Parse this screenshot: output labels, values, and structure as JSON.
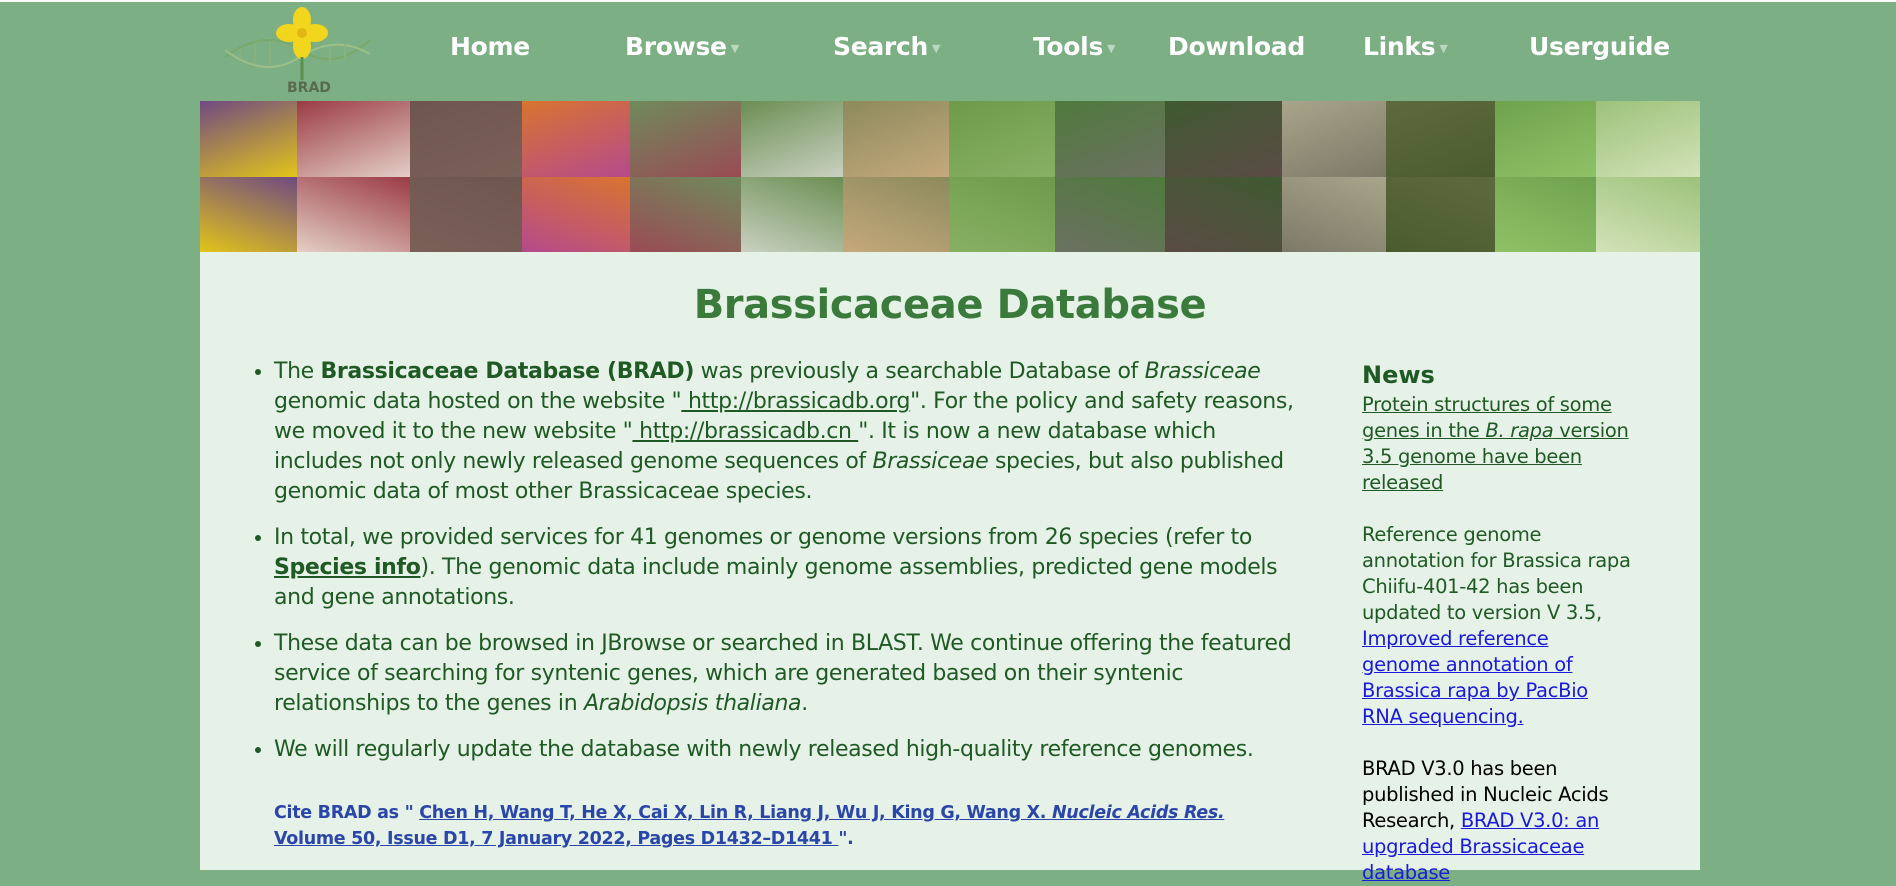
{
  "logo": {
    "text": "BRAD"
  },
  "nav": {
    "home": "Home",
    "browse": "Browse",
    "search": "Search",
    "tools": "Tools",
    "download": "Download",
    "links": "Links",
    "userguide": "Userguide"
  },
  "banner": {
    "tiles": [
      {
        "top": "#6f4a82",
        "bottom": "#e2c41a"
      },
      {
        "top": "#9b3b45",
        "bottom": "#e4cfc6"
      },
      {
        "top": "#6e564f",
        "bottom": "#7b6058"
      },
      {
        "top": "#d9742f",
        "bottom": "#b54a8c"
      },
      {
        "top": "#6f8a5c",
        "bottom": "#9a4b54"
      },
      {
        "top": "#6b8e52",
        "bottom": "#c9d1c1"
      },
      {
        "top": "#8c8a5c",
        "bottom": "#c5a97c"
      },
      {
        "top": "#6e9a4a",
        "bottom": "#88b064"
      },
      {
        "top": "#4f7a3c",
        "bottom": "#6c7162"
      },
      {
        "top": "#3f5a30",
        "bottom": "#5a4b45"
      },
      {
        "top": "#a8a58a",
        "bottom": "#7d7968"
      },
      {
        "top": "#5e6a3e",
        "bottom": "#4a5c2e"
      },
      {
        "top": "#6fa24e",
        "bottom": "#8fc266"
      },
      {
        "top": "#9cc27a",
        "bottom": "#d3e2b8"
      }
    ]
  },
  "main": {
    "title": "Brassicaceae Database",
    "p1": {
      "t1": "The ",
      "b1": "Brassicaceae Database (BRAD)",
      "t2": " was previously a searchable Database of ",
      "i1": "Brassiceae",
      "t3": " genomic data hosted on the website \"",
      "link1": " http://brassicadb.org",
      "t4": "\". For the policy and safety reasons, we moved it to the new website \"",
      "link2": " http://brassicadb.cn ",
      "t5": "\". It is now a new database which includes not only newly released genome sequences of ",
      "i2": "Brassiceae",
      "t6": " species, but also published genomic data of most other Brassicaceae species."
    },
    "p2": {
      "t1": "In total, we provided services for 41 genomes or genome versions from 26 species (refer to ",
      "link": "Species info",
      "t2": "). The genomic data include mainly genome assemblies, predicted gene models and gene annotations."
    },
    "p3": {
      "t1": "These data can be browsed in JBrowse or searched in BLAST. We continue offering the featured service of searching for syntenic genes, which are generated based on their syntenic relationships to the genes in ",
      "i1": "Arabidopsis thaliana",
      "t2": "."
    },
    "p4": "We will regularly update the database with newly released high-quality reference genomes.",
    "cite": {
      "prefix": "Cite BRAD as \" ",
      "authors": "Chen H, Wang T, He X, Cai X, Lin R, Liang J, Wu J, King G, Wang X. ",
      "journal": "Nucleic Acids Res.",
      "details": " Volume 50, Issue D1, 7 January 2022, Pages D1432–D1441 ",
      "suffix": "\"."
    }
  },
  "news": {
    "title": "News",
    "item1": {
      "t1": "Protein structures of some genes in the ",
      "i1": "B. rapa",
      "t2": " version 3.5 genome have been released"
    },
    "item2": {
      "text": "Reference genome annotation for Brassica rapa Chiifu-401-42 has been updated to version V 3.5, ",
      "link": "Improved reference genome annotation of Brassica rapa by PacBio RNA sequencing."
    },
    "item3": {
      "text": "BRAD V3.0 has been published in Nucleic Acids Research, ",
      "link": "BRAD V3.0: an upgraded Brassicaceae database"
    }
  },
  "colors": {
    "page_bg": "#7daf85",
    "panel_bg": "#e6f1e8",
    "title_green": "#3a7a3a",
    "text_green": "#1f5a24",
    "cite_blue": "#2a46a8",
    "link_blue": "#1a1adb"
  }
}
